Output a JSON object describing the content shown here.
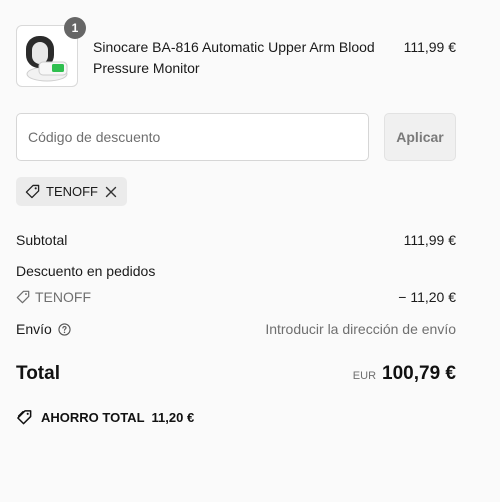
{
  "product": {
    "name": "Sinocare BA-816 Automatic Upper Arm Blood Pressure Monitor",
    "price": "111,99 €",
    "quantity": "1"
  },
  "discount": {
    "placeholder": "Código de descuento",
    "apply_label": "Aplicar",
    "applied_code": "TENOFF"
  },
  "summary": {
    "subtotal_label": "Subtotal",
    "subtotal_value": "111,99 €",
    "order_discount_label": "Descuento en pedidos",
    "discount_code": "TENOFF",
    "discount_value": "− 11,20 €",
    "shipping_label": "Envío",
    "shipping_value": "Introducir la dirección de envío",
    "total_label": "Total",
    "currency": "EUR",
    "total_value": "100,79 €",
    "savings_label": "AHORRO TOTAL",
    "savings_value": "11,20 €"
  },
  "icons": {
    "tag": "tag-icon",
    "close": "close-icon",
    "help": "help-circle-icon"
  },
  "colors": {
    "background": "#fafafa",
    "quantity_badge": "#666666",
    "chip": "#ebebeb",
    "muted_text": "#6f6f6f"
  }
}
